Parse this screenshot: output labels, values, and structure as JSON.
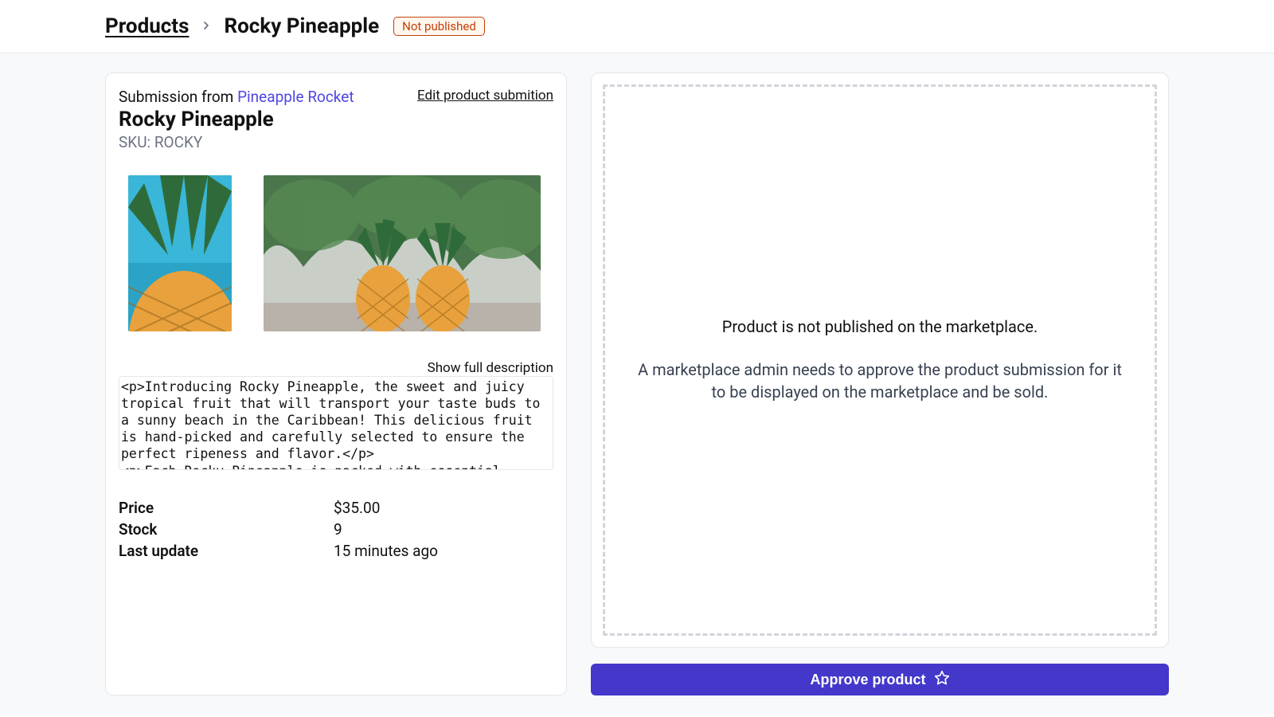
{
  "breadcrumb": {
    "root": "Products",
    "current": "Rocky Pineapple"
  },
  "status_badge": "Not published",
  "submission": {
    "prefix": "Submission from ",
    "vendor": "Pineapple Rocket",
    "edit_link": "Edit product submition"
  },
  "product": {
    "title": "Rocky Pineapple",
    "sku_label": "SKU: ROCKY"
  },
  "description": {
    "show_full": "Show full description",
    "raw_html": "<p>Introducing Rocky Pineapple, the sweet and juicy tropical fruit that will transport your taste buds to a sunny beach in the Caribbean! This delicious fruit is hand-picked and carefully selected to ensure the perfect ripeness and flavor.</p>\n<p>Each Rocky Pineapple is packed with essential vitamins and nutrients, such as vitamin C and fiber, making it a healthy and"
  },
  "meta": {
    "price_label": "Price",
    "price_value": "$35.00",
    "stock_label": "Stock",
    "stock_value": "9",
    "updated_label": "Last update",
    "updated_value": "15 minutes ago"
  },
  "right_panel": {
    "title": "Product is not published on the marketplace.",
    "subtitle": "A marketplace admin needs to approve the product submission for it to be displayed on the marketplace and be sold."
  },
  "actions": {
    "approve": "Approve product"
  }
}
